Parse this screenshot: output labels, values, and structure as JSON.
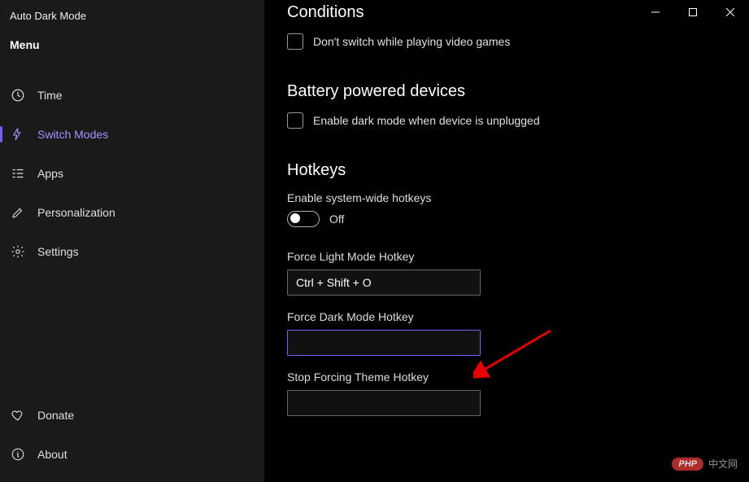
{
  "app_title": "Auto Dark Mode",
  "sidebar": {
    "menu_label": "Menu",
    "items": [
      {
        "label": "Time"
      },
      {
        "label": "Switch Modes"
      },
      {
        "label": "Apps"
      },
      {
        "label": "Personalization"
      },
      {
        "label": "Settings"
      }
    ],
    "bottom": [
      {
        "label": "Donate"
      },
      {
        "label": "About"
      }
    ]
  },
  "content": {
    "conditions": {
      "title": "Conditions",
      "games_label": "Don't switch while playing video games"
    },
    "battery": {
      "title": "Battery powered devices",
      "unplugged_label": "Enable dark mode when device is unplugged"
    },
    "hotkeys": {
      "title": "Hotkeys",
      "enable_label": "Enable system-wide hotkeys",
      "toggle_state": "Off",
      "force_light_label": "Force Light Mode Hotkey",
      "force_light_value": "Ctrl + Shift + O",
      "force_dark_label": "Force Dark Mode Hotkey",
      "force_dark_value": "",
      "stop_forcing_label": "Stop Forcing Theme Hotkey",
      "stop_forcing_value": ""
    }
  },
  "watermark": {
    "badge": "PHP",
    "text": "中文网"
  }
}
